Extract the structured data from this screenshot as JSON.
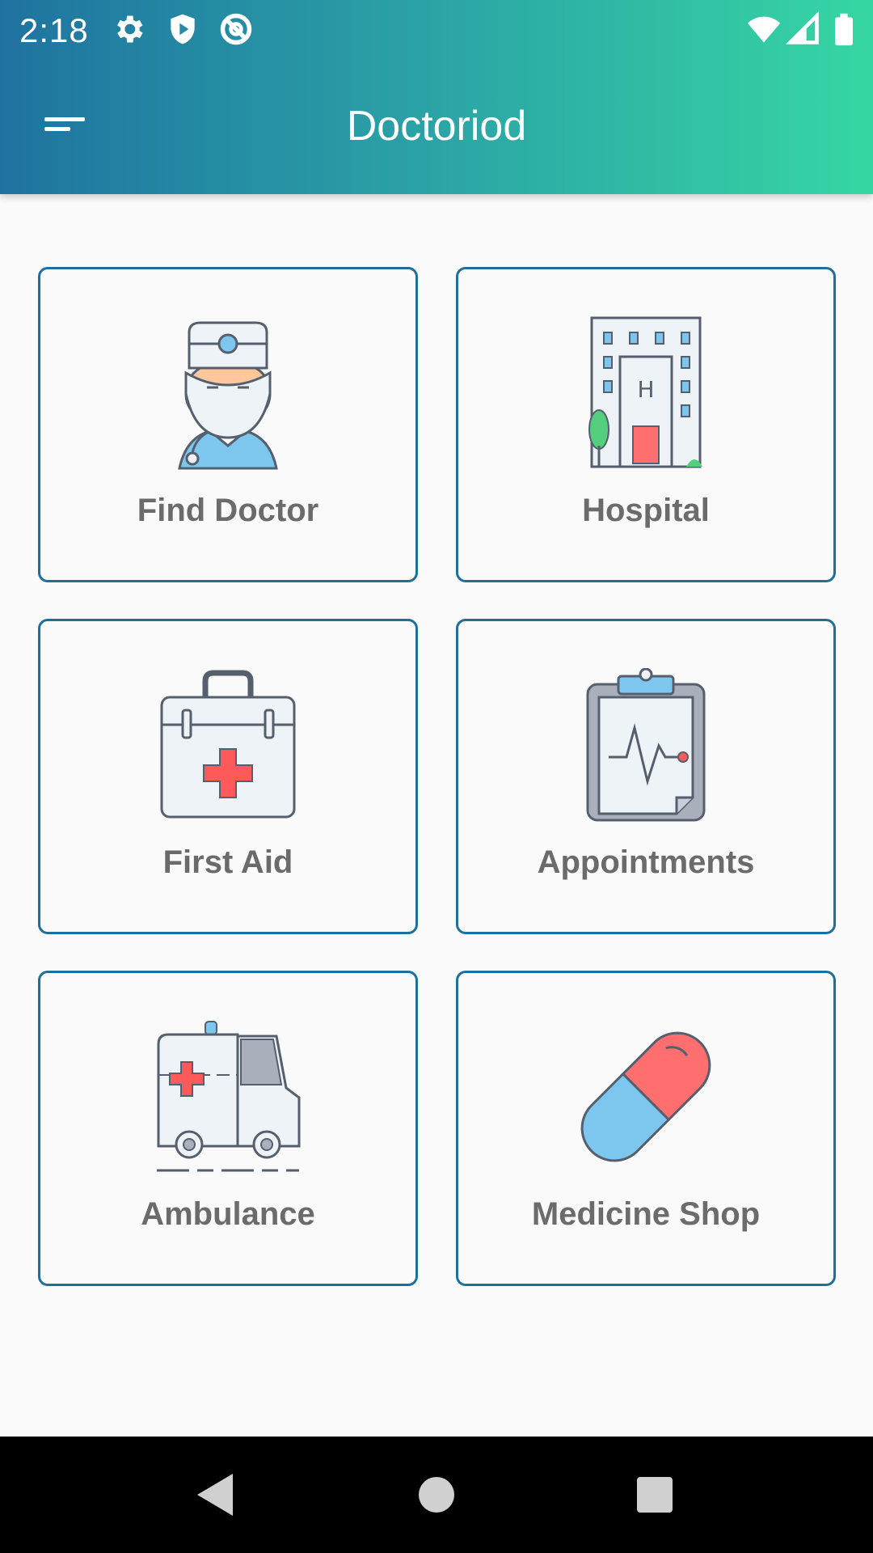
{
  "status_bar": {
    "time": "2:18",
    "left_icons": [
      "gear-icon",
      "shield-play-icon",
      "at-sign-icon"
    ],
    "right_icons": [
      "wifi-icon",
      "signal-icon",
      "battery-icon"
    ]
  },
  "toolbar": {
    "title": "Doctoriod",
    "menu_icon": "menu-icon"
  },
  "colors": {
    "gradient_start": "#1f73a0",
    "gradient_end": "#36d6a3",
    "card_border": "#1e6f9a",
    "label_text": "#6b6b6b"
  },
  "cards": [
    {
      "label": "Find Doctor",
      "icon": "doctor-icon"
    },
    {
      "label": "Hospital",
      "icon": "hospital-icon"
    },
    {
      "label": "First Aid",
      "icon": "first-aid-kit-icon"
    },
    {
      "label": "Appointments",
      "icon": "clipboard-heartbeat-icon"
    },
    {
      "label": "Ambulance",
      "icon": "ambulance-icon"
    },
    {
      "label": "Medicine Shop",
      "icon": "pill-capsule-icon"
    }
  ],
  "nav_bar": {
    "buttons": [
      "back-icon",
      "home-icon",
      "recents-icon"
    ]
  }
}
